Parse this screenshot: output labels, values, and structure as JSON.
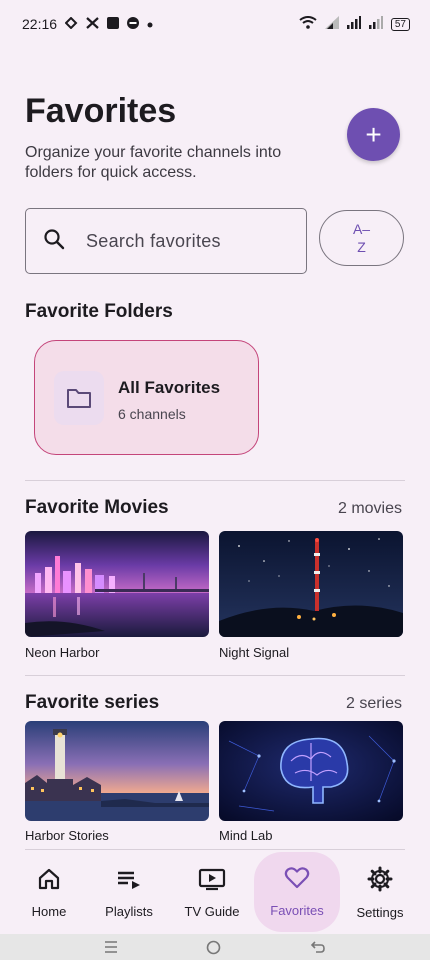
{
  "status_bar": {
    "time": "22:16",
    "battery": "57",
    "icons": [
      "signal-icon",
      "network-icon",
      "app-icon",
      "dnd-icon",
      "dot-icon",
      "wifi-icon",
      "cell-signal-icon"
    ]
  },
  "header": {
    "title": "Favorites",
    "subtitle": "Organize your favorite channels into folders for quick access.",
    "add_label": "+"
  },
  "search": {
    "placeholder": "Search favorites",
    "value": ""
  },
  "sort": {
    "line1": "A–",
    "line2": "Z"
  },
  "folders": {
    "title": "Favorite Folders",
    "items": [
      {
        "name": "All Favorites",
        "count": "6 channels"
      }
    ]
  },
  "movies": {
    "title": "Favorite Movies",
    "count": "2 movies",
    "items": [
      {
        "label": "Neon Harbor"
      },
      {
        "label": "Night Signal"
      }
    ]
  },
  "series": {
    "title": "Favorite series",
    "count": "2 series",
    "items": [
      {
        "label": "Harbor Stories"
      },
      {
        "label": "Mind Lab"
      }
    ]
  },
  "nav": {
    "items": [
      {
        "label": "Home",
        "icon": "home-icon"
      },
      {
        "label": "Playlists",
        "icon": "playlist-icon"
      },
      {
        "label": "TV Guide",
        "icon": "tv-guide-icon"
      },
      {
        "label": "Favorites",
        "icon": "heart-icon",
        "active": true
      },
      {
        "label": "Settings",
        "icon": "gear-icon"
      }
    ]
  },
  "colors": {
    "accent": "#6e4fb1",
    "background": "#f7eff7",
    "folder_border": "#c4457a",
    "active_nav": "#f0d8ee"
  }
}
